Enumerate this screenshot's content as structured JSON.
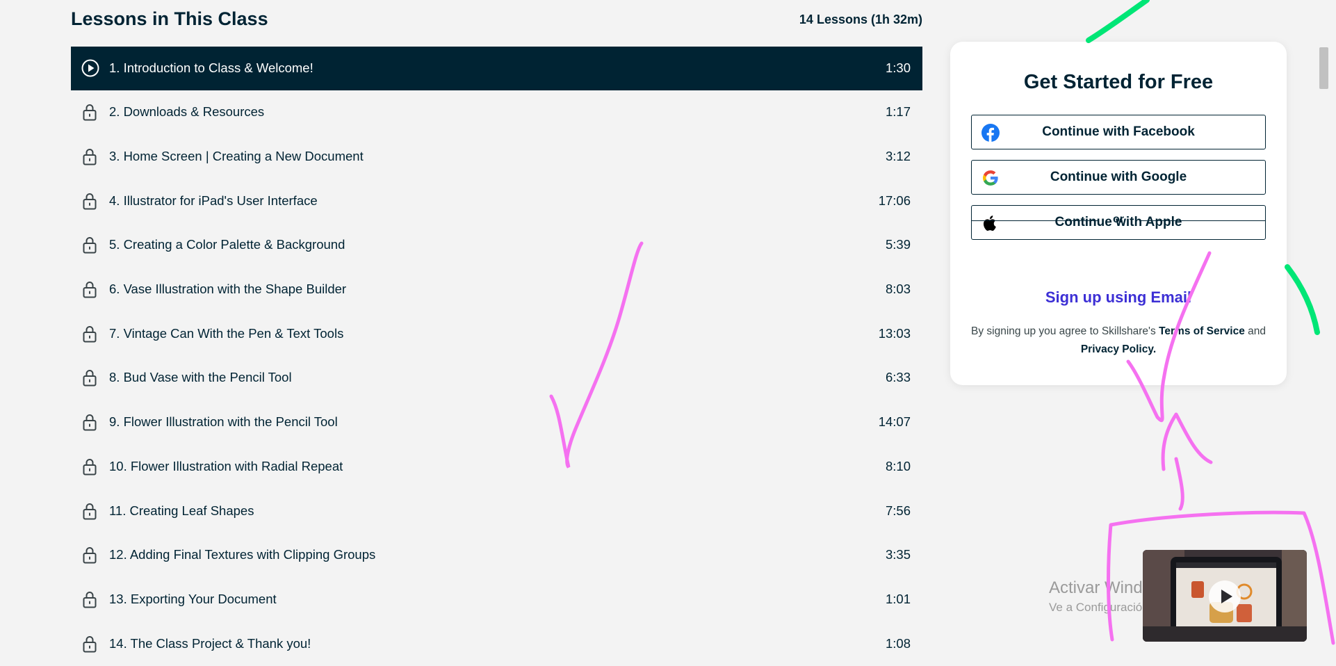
{
  "lessons": {
    "title": "Lessons in This Class",
    "count": "14 Lessons (1h 32m)",
    "items": [
      {
        "title": "1. Introduction to Class & Welcome!",
        "duration": "1:30",
        "state": "playing"
      },
      {
        "title": "2. Downloads & Resources",
        "duration": "1:17",
        "state": "locked"
      },
      {
        "title": "3. Home Screen | Creating a New Document",
        "duration": "3:12",
        "state": "locked"
      },
      {
        "title": "4. Illustrator for iPad's User Interface",
        "duration": "17:06",
        "state": "locked"
      },
      {
        "title": "5. Creating a Color Palette & Background",
        "duration": "5:39",
        "state": "locked"
      },
      {
        "title": "6. Vase Illustration with the Shape Builder",
        "duration": "8:03",
        "state": "locked"
      },
      {
        "title": "7. Vintage Can With the Pen & Text Tools",
        "duration": "13:03",
        "state": "locked"
      },
      {
        "title": "8. Bud Vase with the Pencil Tool",
        "duration": "6:33",
        "state": "locked"
      },
      {
        "title": "9. Flower Illustration with the Pencil Tool",
        "duration": "14:07",
        "state": "locked"
      },
      {
        "title": "10. Flower Illustration with Radial Repeat",
        "duration": "8:10",
        "state": "locked"
      },
      {
        "title": "11. Creating Leaf Shapes",
        "duration": "7:56",
        "state": "locked"
      },
      {
        "title": "12. Adding Final Textures with Clipping Groups",
        "duration": "3:35",
        "state": "locked"
      },
      {
        "title": "13. Exporting Your Document",
        "duration": "1:01",
        "state": "locked"
      },
      {
        "title": "14. The Class Project & Thank you!",
        "duration": "1:08",
        "state": "locked"
      }
    ]
  },
  "signup": {
    "title": "Get Started for Free",
    "facebook_label": "Continue with Facebook",
    "google_label": "Continue with Google",
    "apple_label": "Continue with Apple",
    "or_text": "or",
    "email_label": "Sign up using Email",
    "legal_prefix": "By signing up you agree to Skillshare's ",
    "terms_label": "Terms of Service",
    "legal_and": " and ",
    "privacy_label": "Privacy Policy",
    "legal_suffix": "."
  },
  "watermark": {
    "line1": "Activar Windows",
    "line2": "Ve a Configuración para activar Windows."
  },
  "icons": {
    "playing": "play-circle-icon",
    "locked": "lock-icon",
    "facebook": "facebook-icon",
    "google": "google-icon",
    "apple": "apple-icon",
    "video": "play-icon"
  },
  "colors": {
    "navy": "#002333",
    "page_bg": "#f3f3f3",
    "email_link": "#3c2fd5",
    "facebook_blue": "#1877f2",
    "annotation_pink": "#f571f0",
    "annotation_green": "#00e676"
  }
}
